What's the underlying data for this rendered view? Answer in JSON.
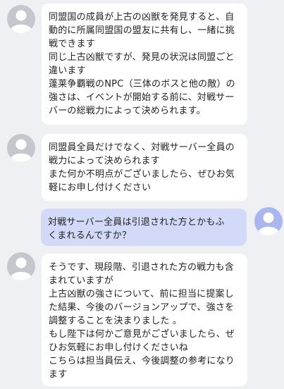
{
  "colors": {
    "background": "#eff0f3",
    "agent_bubble": "#ffffff",
    "user_bubble": "#d3daf8",
    "agent_avatar": "#c4c7ce",
    "user_avatar": "#a9b6f0"
  },
  "messages": [
    {
      "sender": "agent",
      "avatar_icon": "person-avatar-icon",
      "lines": [
        "同盟国の成員が上古の凶獣を発見すると、自",
        "動的に所属同盟国の盟友に共有し、一緒に挑",
        "戦できます",
        "同じ上古凶獣ですが、発見の状況は同盟ごと",
        "違います",
        "蓬莱争覇戦のNPC（三体のボスと他の敵）の",
        "強さは、イベントが開始する前に、対戦サー",
        "バーの総戦力によって決められます。"
      ]
    },
    {
      "sender": "agent",
      "avatar_icon": "person-avatar-icon",
      "lines": [
        "同盟員全員だけでなく、対戦サーバー全員の",
        "戦力によって決められます",
        "また何か不明点がございましたら、ぜひお気",
        "軽にお申し付けください"
      ]
    },
    {
      "sender": "user",
      "avatar_icon": "person-avatar-icon",
      "lines": [
        "対戦サーバー全員は引退された方とかもふ",
        "くまれるんですか？"
      ]
    },
    {
      "sender": "agent",
      "avatar_icon": "person-avatar-icon",
      "lines": [
        "そうです、現段階、引退された方の戦力も含",
        "まれていますが",
        "上古凶獣の強さについて、前に担当に提案し",
        "た結果、今後のバージョンアップで、強さを",
        "調整することを決まりました 。",
        "もし陛下は何かご意見がございましたら、ぜ",
        "ひお気軽にお申し付けくださいね",
        "こちらは担当員伝え、今後調整の参考になり",
        "ます"
      ]
    }
  ]
}
